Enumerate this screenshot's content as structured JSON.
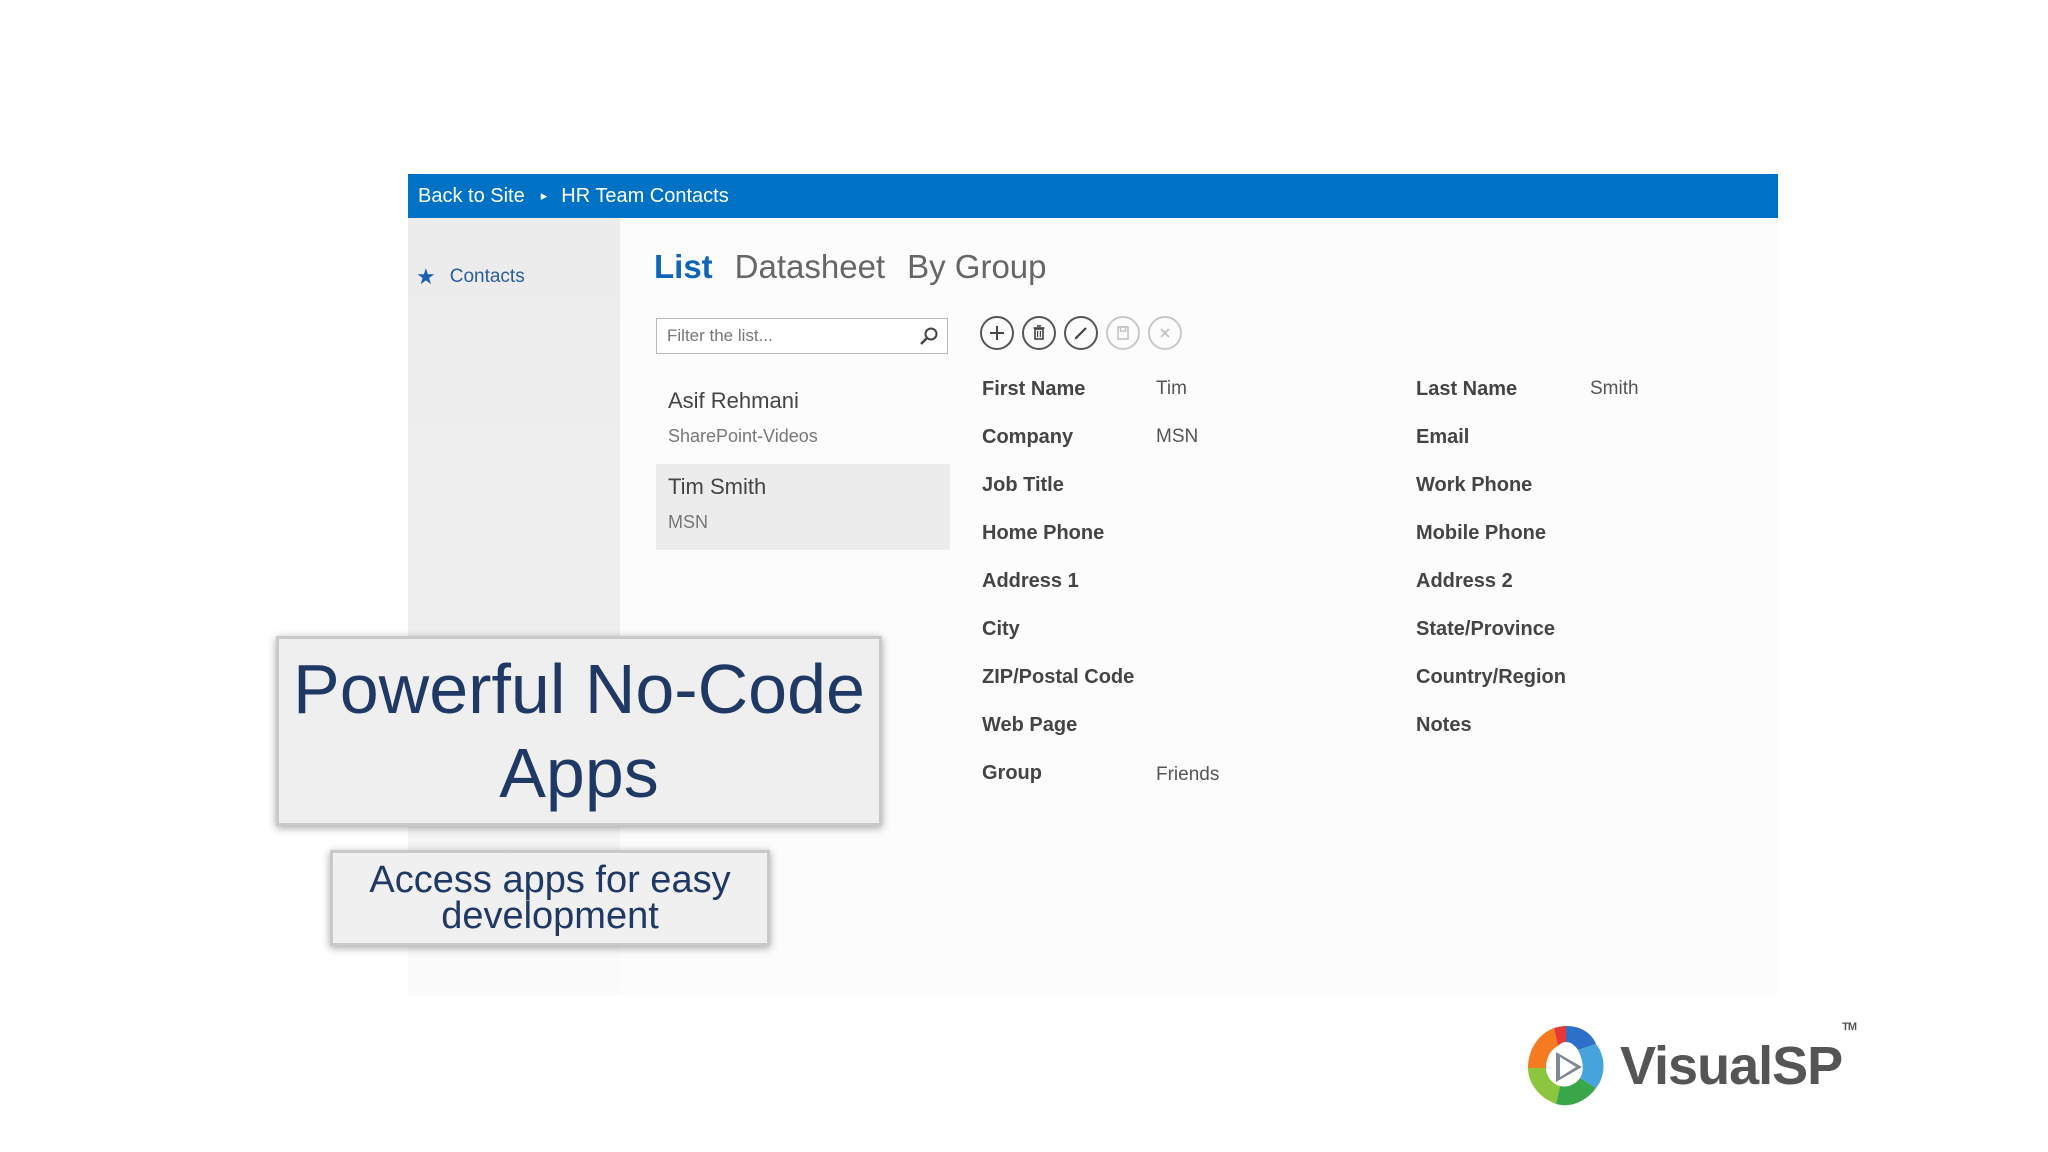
{
  "topbar": {
    "back_label": "Back to Site",
    "current_label": "HR Team Contacts"
  },
  "leftnav": {
    "items": [
      {
        "label": "Contacts",
        "icon": "star-icon"
      }
    ]
  },
  "views": {
    "tabs": [
      {
        "label": "List",
        "active": true
      },
      {
        "label": "Datasheet",
        "active": false
      },
      {
        "label": "By Group",
        "active": false
      }
    ]
  },
  "filter": {
    "placeholder": "Filter the list..."
  },
  "actions": [
    {
      "icon": "add-icon",
      "enabled": true
    },
    {
      "icon": "delete-icon",
      "enabled": true
    },
    {
      "icon": "edit-icon",
      "enabled": true
    },
    {
      "icon": "save-icon",
      "enabled": false
    },
    {
      "icon": "cancel-icon",
      "enabled": false
    }
  ],
  "contacts": [
    {
      "name": "Asif Rehmani",
      "company": "SharePoint-Videos",
      "selected": false
    },
    {
      "name": "Tim Smith",
      "company": "MSN",
      "selected": true
    }
  ],
  "details": {
    "first_name": {
      "label": "First Name",
      "value": "Tim"
    },
    "last_name": {
      "label": "Last Name",
      "value": "Smith"
    },
    "company": {
      "label": "Company",
      "value": "MSN"
    },
    "email": {
      "label": "Email",
      "value": ""
    },
    "job_title": {
      "label": "Job Title",
      "value": ""
    },
    "work_phone": {
      "label": "Work Phone",
      "value": ""
    },
    "home_phone": {
      "label": "Home Phone",
      "value": ""
    },
    "mobile_phone": {
      "label": "Mobile Phone",
      "value": ""
    },
    "address1": {
      "label": "Address 1",
      "value": ""
    },
    "address2": {
      "label": "Address 2",
      "value": ""
    },
    "city": {
      "label": "City",
      "value": ""
    },
    "state": {
      "label": "State/Province",
      "value": ""
    },
    "zip": {
      "label": "ZIP/Postal Code",
      "value": ""
    },
    "country": {
      "label": "Country/Region",
      "value": ""
    },
    "web_page": {
      "label": "Web Page",
      "value": ""
    },
    "notes": {
      "label": "Notes",
      "value": ""
    },
    "group": {
      "label": "Group",
      "value": "Friends"
    }
  },
  "slide": {
    "title_line1": "Powerful No-Code",
    "title_line2": "Apps",
    "subtitle_line1": "Access apps for easy",
    "subtitle_line2": "development"
  },
  "logo": {
    "text": "VisualSP",
    "tm": "TM"
  },
  "colors": {
    "topbar": "#0072c6",
    "active_tab": "#0f66b8",
    "title_text": "#1f3864"
  }
}
